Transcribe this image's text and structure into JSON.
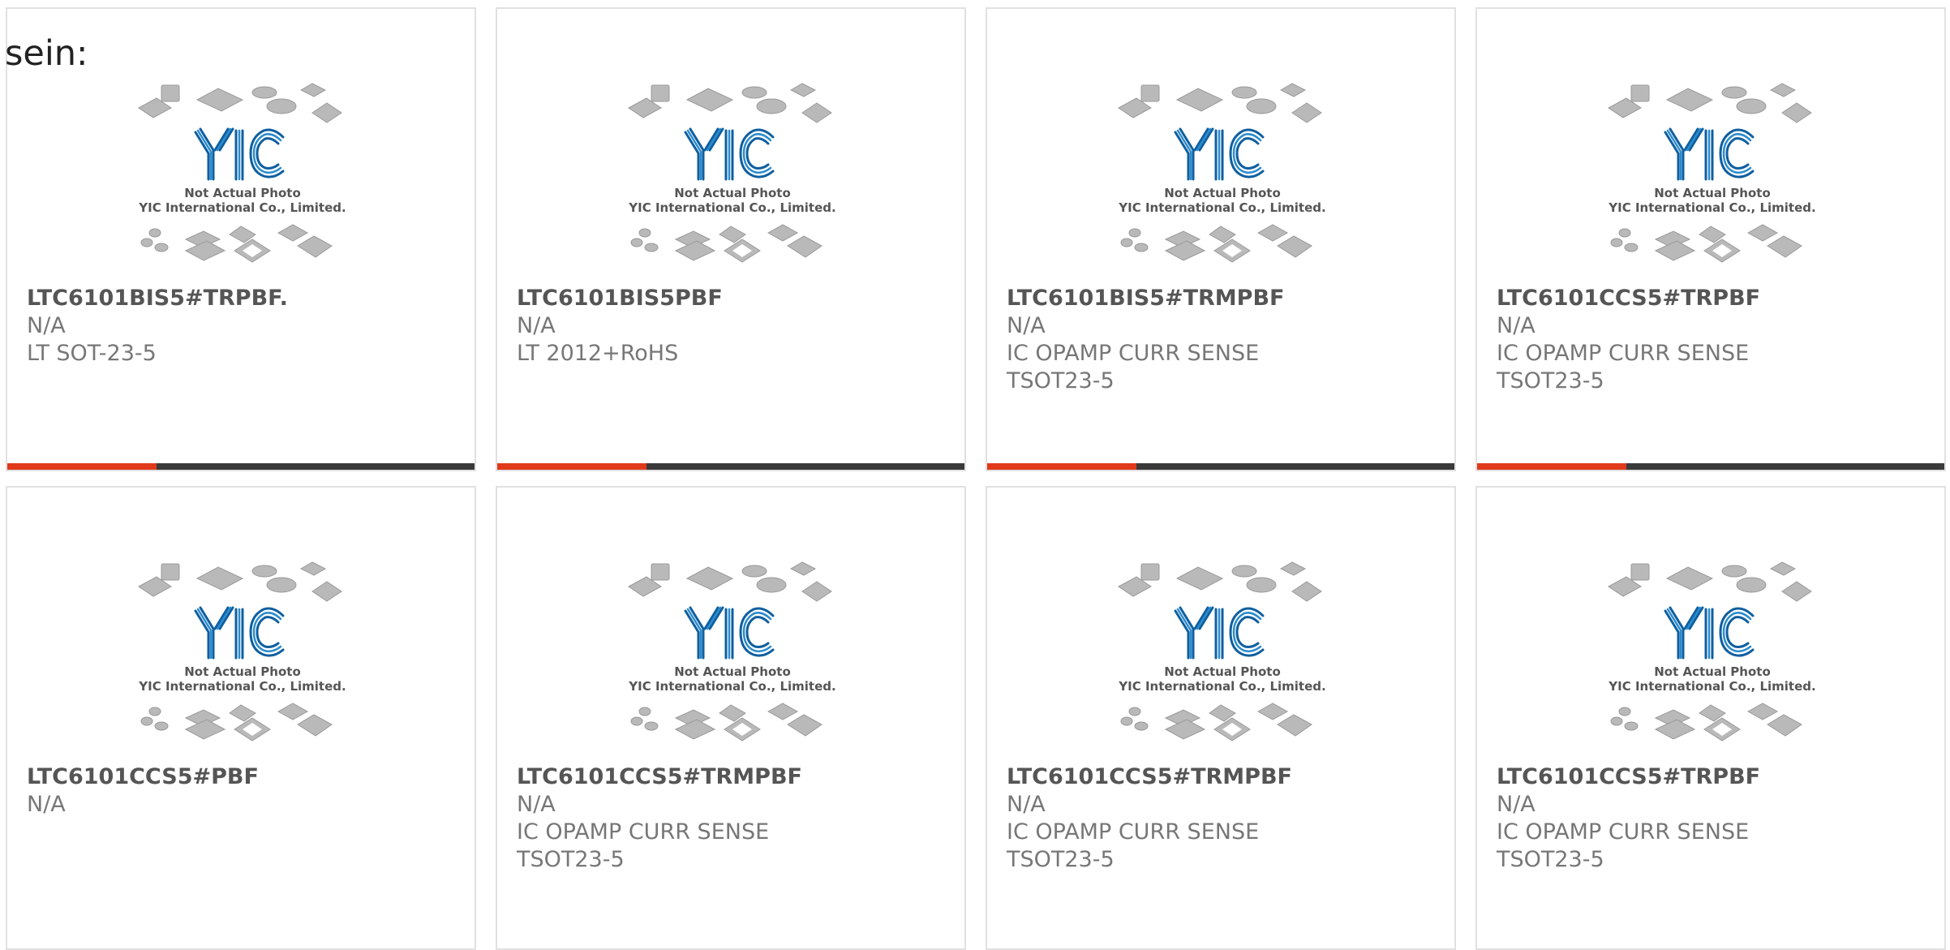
{
  "heading": "sein:",
  "colors": {
    "accent": "#e03a1b",
    "bar_dark": "#3a3a3a",
    "logo_blue": "#2a8ccf",
    "logo_outline": "#0f5fa0",
    "chip_gray": "#b9b9b9",
    "card_border": "#e1e1e1"
  },
  "thumbnail": {
    "icon": "yic-chip-placeholder-icon",
    "logo_text": "YIC",
    "caption_line1": "Not Actual Photo",
    "caption_line2": "YIC International Co., Limited."
  },
  "products": [
    {
      "part": "LTC6101BIS5#TRPBF.",
      "stock": "N/A",
      "desc": "LT SOT-23-5",
      "progress_pct": 32
    },
    {
      "part": "LTC6101BIS5PBF",
      "stock": "N/A",
      "desc": "LT 2012+RoHS",
      "progress_pct": 32
    },
    {
      "part": "LTC6101BIS5#TRMPBF",
      "stock": "N/A",
      "desc": "IC OPAMP CURR SENSE TSOT23-5",
      "progress_pct": 32
    },
    {
      "part": "LTC6101CCS5#TRPBF",
      "stock": "N/A",
      "desc": "IC OPAMP CURR SENSE TSOT23-5",
      "progress_pct": 32
    },
    {
      "part": "LTC6101CCS5#PBF",
      "stock": "N/A",
      "desc": ""
    },
    {
      "part": "LTC6101CCS5#TRMPBF",
      "stock": "N/A",
      "desc": "IC OPAMP CURR SENSE TSOT23-5"
    },
    {
      "part": "LTC6101CCS5#TRMPBF",
      "stock": "N/A",
      "desc": "IC OPAMP CURR SENSE TSOT23-5"
    },
    {
      "part": "LTC6101CCS5#TRPBF",
      "stock": "N/A",
      "desc": "IC OPAMP CURR SENSE TSOT23-5"
    }
  ]
}
